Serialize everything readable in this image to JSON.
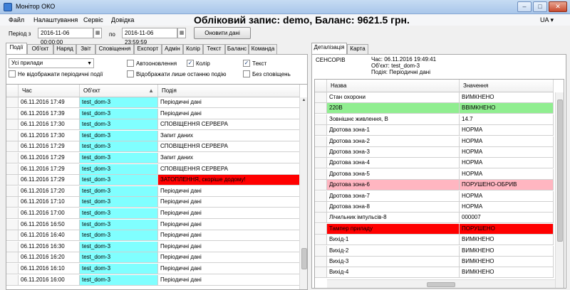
{
  "window": {
    "title": "Монітор ОКО"
  },
  "menu": {
    "items": [
      "Файл",
      "Налаштування",
      "Сервіс",
      "Довідка"
    ]
  },
  "account": {
    "title": "Обліковий запис: demo, Баланс: 9621.5 грн.",
    "lang": "UA"
  },
  "period": {
    "from_label": "Період з",
    "from_value": "2016-11-06 00:00:00",
    "to_label": "по",
    "to_value": "2016-11-06 23:59:59",
    "refresh_label": "Оновити дані"
  },
  "left_tabs": [
    "Події",
    "Об'єкт",
    "Наряд",
    "Звіт",
    "Сповіщення",
    "Експорт",
    "Адмін",
    "Колір",
    "Текст",
    "Баланс",
    "Команда"
  ],
  "filters": {
    "devices": "Усі прилади",
    "no_periodic": "Не відображати періодичні події",
    "auto_update": "Автооновлення",
    "color": "Колір",
    "text": "Текст",
    "last_only": "Відображати лише останню подію",
    "no_alerts": "Без сповіщень"
  },
  "events": {
    "headers": {
      "time": "Час",
      "object": "Об'єкт",
      "event": "Подія"
    },
    "rows": [
      {
        "time": "06.11.2016 17:49",
        "object": "test_dom-3",
        "event": "Періодичні дані",
        "style": ""
      },
      {
        "time": "06.11.2016 17:39",
        "object": "test_dom-3",
        "event": "Періодичні дані",
        "style": ""
      },
      {
        "time": "06.11.2016 17:30",
        "object": "test_dom-3",
        "event": "СПОВІЩЕННЯ СЕРВЕРА",
        "style": ""
      },
      {
        "time": "06.11.2016 17:30",
        "object": "test_dom-3",
        "event": "Запит даних",
        "style": ""
      },
      {
        "time": "06.11.2016 17:29",
        "object": "test_dom-3",
        "event": "СПОВІЩЕННЯ СЕРВЕРА",
        "style": ""
      },
      {
        "time": "06.11.2016 17:29",
        "object": "test_dom-3",
        "event": "Запит даних",
        "style": ""
      },
      {
        "time": "06.11.2016 17:29",
        "object": "test_dom-3",
        "event": "СПОВІЩЕННЯ СЕРВЕРА",
        "style": ""
      },
      {
        "time": "06.11.2016 17:29",
        "object": "test_dom-3",
        "event": "ЗАТОПЛЕННЯ, скоріше додому!",
        "style": "red"
      },
      {
        "time": "06.11.2016 17:20",
        "object": "test_dom-3",
        "event": "Періодичні дані",
        "style": ""
      },
      {
        "time": "06.11.2016 17:10",
        "object": "test_dom-3",
        "event": "Періодичні дані",
        "style": ""
      },
      {
        "time": "06.11.2016 17:00",
        "object": "test_dom-3",
        "event": "Періодичні дані",
        "style": ""
      },
      {
        "time": "06.11.2016 16:50",
        "object": "test_dom-3",
        "event": "Періодичні дані",
        "style": ""
      },
      {
        "time": "06.11.2016 16:40",
        "object": "test_dom-3",
        "event": "Періодичні дані",
        "style": ""
      },
      {
        "time": "06.11.2016 16:30",
        "object": "test_dom-3",
        "event": "Періодичні дані",
        "style": ""
      },
      {
        "time": "06.11.2016 16:20",
        "object": "test_dom-3",
        "event": "Періодичні дані",
        "style": ""
      },
      {
        "time": "06.11.2016 16:10",
        "object": "test_dom-3",
        "event": "Періодичні дані",
        "style": ""
      },
      {
        "time": "06.11.2016 16:00",
        "object": "test_dom-3",
        "event": "Періодичні дані",
        "style": ""
      }
    ]
  },
  "right_tabs": [
    "Деталізація",
    "Карта"
  ],
  "detail": {
    "sensors_label": "СЕНСОРІВ",
    "time_line": "Час: 06.11.2016 19:49:41",
    "object_line": "Об'єкт: test_dom-3",
    "event_line": "Подія: Періодичні дані",
    "headers": {
      "name": "Назва",
      "value": "Значення"
    },
    "rows": [
      {
        "name": "Стан охорони",
        "value": "ВИМКНЕНО",
        "style": ""
      },
      {
        "name": "220В",
        "value": "ВВІМКНЕНО",
        "style": "green"
      },
      {
        "name": "Зовнішнє живлення, В",
        "value": "14.7",
        "style": ""
      },
      {
        "name": "Дротова зона-1",
        "value": "НОРМА",
        "style": ""
      },
      {
        "name": "Дротова зона-2",
        "value": "НОРМА",
        "style": ""
      },
      {
        "name": "Дротова зона-3",
        "value": "НОРМА",
        "style": ""
      },
      {
        "name": "Дротова зона-4",
        "value": "НОРМА",
        "style": ""
      },
      {
        "name": "Дротова зона-5",
        "value": "НОРМА",
        "style": ""
      },
      {
        "name": "Дротова зона-6",
        "value": "ПОРУШЕНО-ОБРИВ",
        "style": "pink"
      },
      {
        "name": "Дротова зона-7",
        "value": "НОРМА",
        "style": ""
      },
      {
        "name": "Дротова зона-8",
        "value": "НОРМА",
        "style": ""
      },
      {
        "name": "Лічильник імпульсів-8",
        "value": "000007",
        "style": ""
      },
      {
        "name": "Тампер приладу",
        "value": "ПОРУШЕНО",
        "style": "red"
      },
      {
        "name": "Вихід-1",
        "value": "ВИМКНЕНО",
        "style": ""
      },
      {
        "name": "Вихід-2",
        "value": "ВИМКНЕНО",
        "style": ""
      },
      {
        "name": "Вихід-3",
        "value": "ВИМКНЕНО",
        "style": ""
      },
      {
        "name": "Вихід-4",
        "value": "ВИМКНЕНО",
        "style": ""
      }
    ]
  }
}
